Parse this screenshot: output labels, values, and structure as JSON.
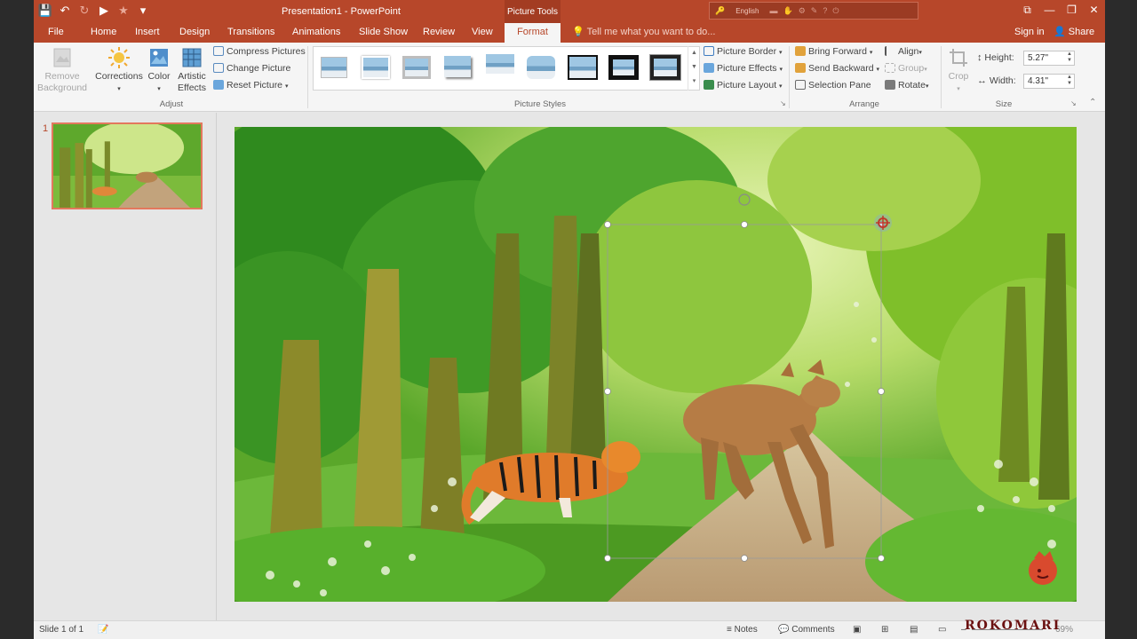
{
  "window": {
    "title": "Presentation1 - PowerPoint",
    "context_tab_group": "Picture Tools",
    "language": "English"
  },
  "tabs": [
    "File",
    "Home",
    "Insert",
    "Design",
    "Transitions",
    "Animations",
    "Slide Show",
    "Review",
    "View",
    "Format"
  ],
  "active_tab": "Format",
  "tell_me": "Tell me what you want to do...",
  "account": {
    "sign_in": "Sign in",
    "share": "Share"
  },
  "ribbon": {
    "adjust": {
      "remove_background": [
        "Remove",
        "Background"
      ],
      "corrections": "Corrections",
      "color": "Color",
      "artistic_effects": [
        "Artistic",
        "Effects"
      ],
      "compress_pictures": "Compress Pictures",
      "change_picture": "Change Picture",
      "reset_picture": "Reset Picture",
      "label": "Adjust"
    },
    "picture_styles": {
      "picture_border": "Picture Border",
      "picture_effects": "Picture Effects",
      "picture_layout": "Picture Layout",
      "label": "Picture Styles"
    },
    "arrange": {
      "bring_forward": "Bring Forward",
      "send_backward": "Send Backward",
      "selection_pane": "Selection Pane",
      "align": "Align",
      "group": "Group",
      "rotate": "Rotate",
      "label": "Arrange"
    },
    "size": {
      "crop": "Crop",
      "height_label": "Height:",
      "height_value": "5.27\"",
      "width_label": "Width:",
      "width_value": "4.31\"",
      "label": "Size"
    }
  },
  "thumbnails": {
    "slide_number": "1"
  },
  "status": {
    "slide_info": "Slide 1 of 1",
    "notes": "Notes",
    "comments": "Comments",
    "zoom": "69%"
  },
  "watermark": "ROKOMARI",
  "colors": {
    "accent": "#b7472a",
    "ribbon_bg": "#f5f5f5",
    "workspace_bg": "#e6e6e6",
    "thumb_border": "#e3785d"
  }
}
